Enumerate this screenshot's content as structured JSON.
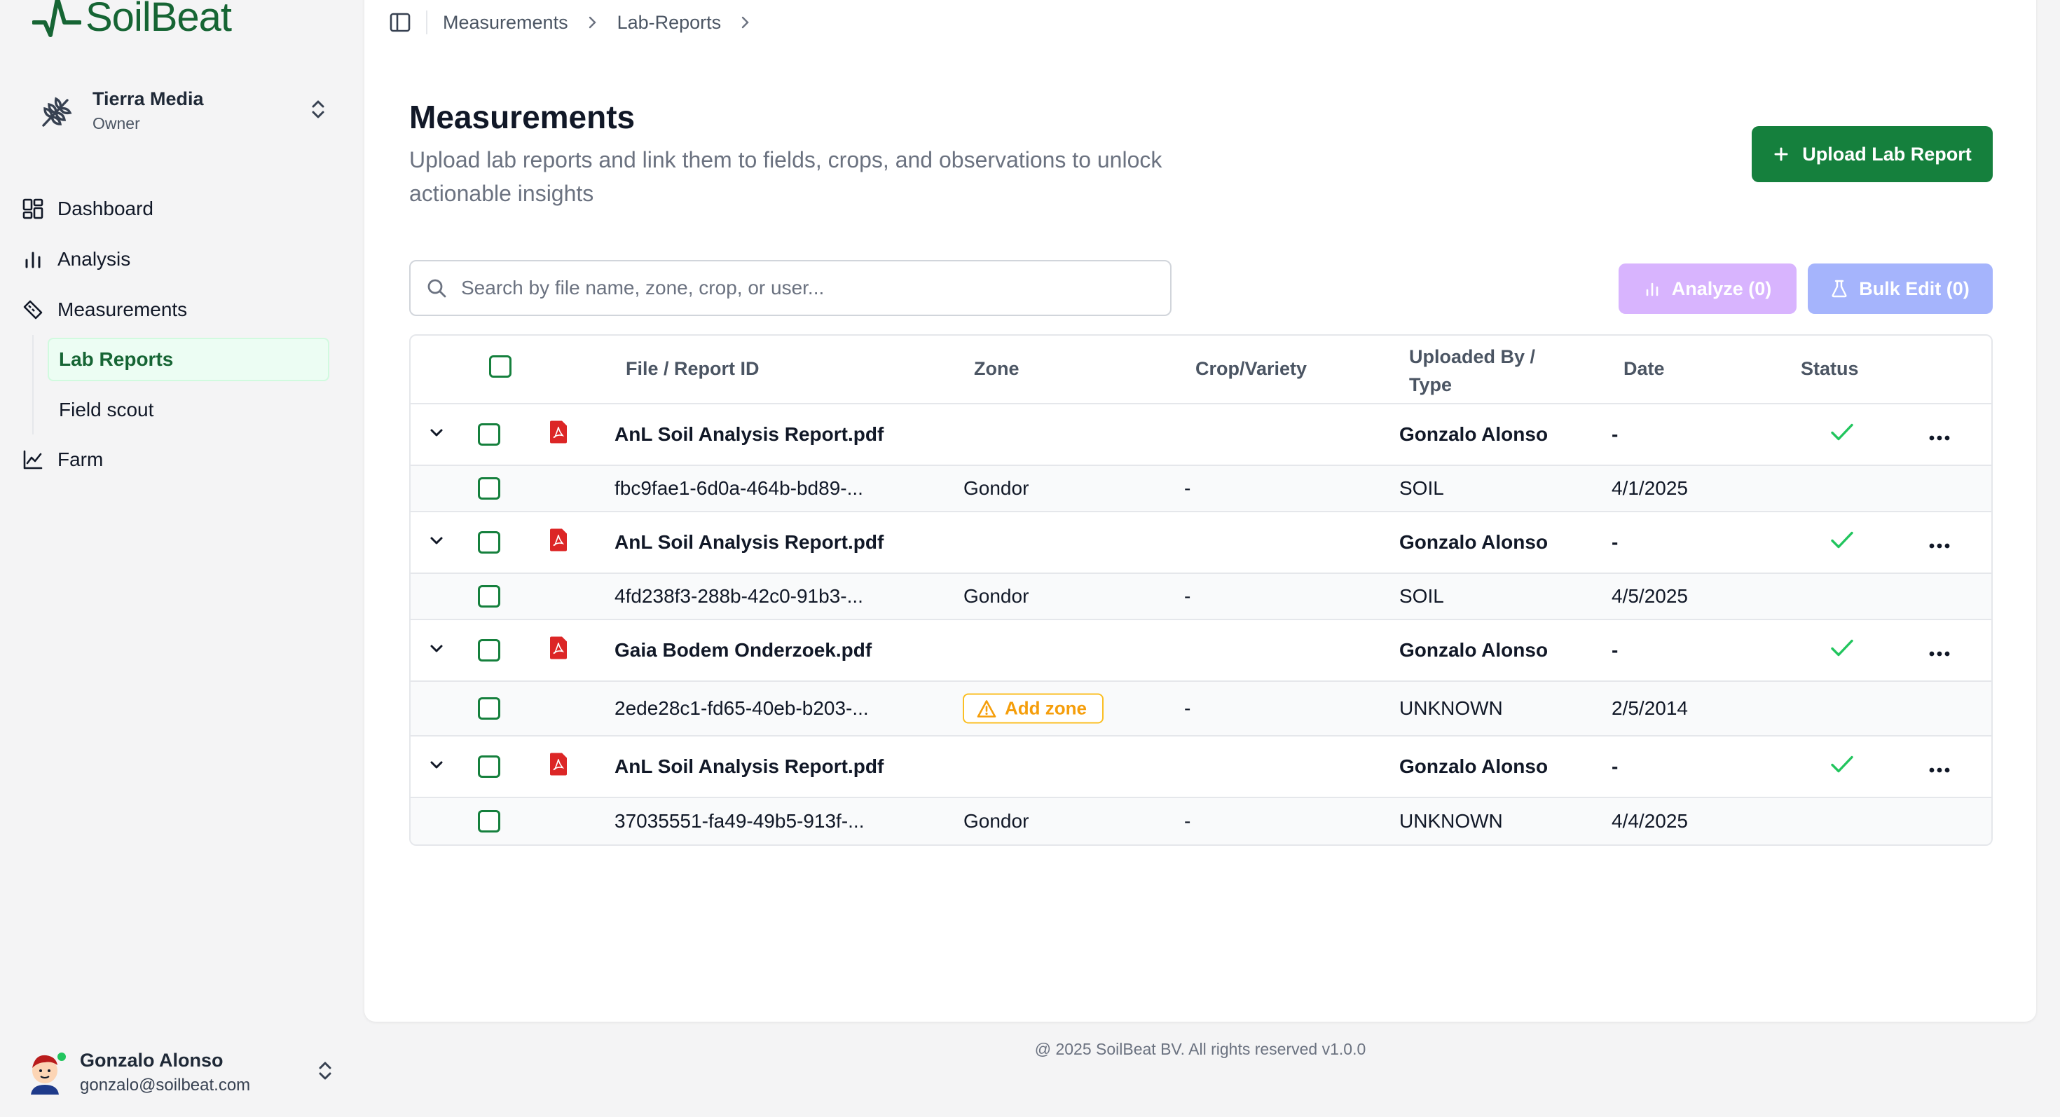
{
  "brand": {
    "name": "SoilBeat",
    "color": "#166534"
  },
  "org": {
    "name": "Tierra Media",
    "role": "Owner",
    "icon": "wheat-icon"
  },
  "nav": {
    "dashboard": "Dashboard",
    "analysis": "Analysis",
    "measurements": "Measurements",
    "lab_reports": "Lab Reports",
    "field_scout": "Field scout",
    "farm": "Farm"
  },
  "user": {
    "name": "Gonzalo Alonso",
    "email": "gonzalo@soilbeat.com"
  },
  "breadcrumb": {
    "items": [
      "Measurements",
      "Lab-Reports"
    ]
  },
  "page": {
    "title": "Measurements",
    "subtitle": "Upload lab reports and link them to fields, crops, and observations to unlock actionable insights"
  },
  "actions": {
    "upload": "Upload Lab Report",
    "analyze": "Analyze (0)",
    "bulk_edit": "Bulk Edit (0)"
  },
  "search": {
    "placeholder": "Search by file name, zone, crop, or user...",
    "value": ""
  },
  "table": {
    "headers": {
      "file": "File / Report ID",
      "zone": "Zone",
      "crop": "Crop/Variety",
      "uploaded": "Uploaded By / Type",
      "date": "Date",
      "status": "Status"
    },
    "groups": [
      {
        "file": "AnL Soil Analysis Report.pdf",
        "uploader": "Gonzalo Alonso",
        "date": "-",
        "status": "check",
        "child": {
          "id": "fbc9fae1-6d0a-464b-bd89-...",
          "zone": "Gondor",
          "crop": "-",
          "type": "SOIL",
          "date": "4/1/2025"
        }
      },
      {
        "file": "AnL Soil Analysis Report.pdf",
        "uploader": "Gonzalo Alonso",
        "date": "-",
        "status": "check",
        "child": {
          "id": "4fd238f3-288b-42c0-91b3-...",
          "zone": "Gondor",
          "crop": "-",
          "type": "SOIL",
          "date": "4/5/2025"
        }
      },
      {
        "file": "Gaia Bodem Onderzoek.pdf",
        "uploader": "Gonzalo Alonso",
        "date": "-",
        "status": "check",
        "child": {
          "id": "2ede28c1-fd65-40eb-b203-...",
          "zone_action": "Add zone",
          "crop": "-",
          "type": "UNKNOWN",
          "date": "2/5/2014"
        }
      },
      {
        "file": "AnL Soil Analysis Report.pdf",
        "uploader": "Gonzalo Alonso",
        "date": "-",
        "status": "check",
        "child": {
          "id": "37035551-fa49-49b5-913f-...",
          "zone": "Gondor",
          "crop": "-",
          "type": "UNKNOWN",
          "date": "4/4/2025"
        }
      }
    ]
  },
  "footer": "@ 2025 SoilBeat BV. All rights reserved v1.0.0",
  "colors": {
    "primary": "#15803d",
    "analyze": "#d8b4fe",
    "bulk": "#a5b4fc",
    "warning": "#f59e0b"
  }
}
